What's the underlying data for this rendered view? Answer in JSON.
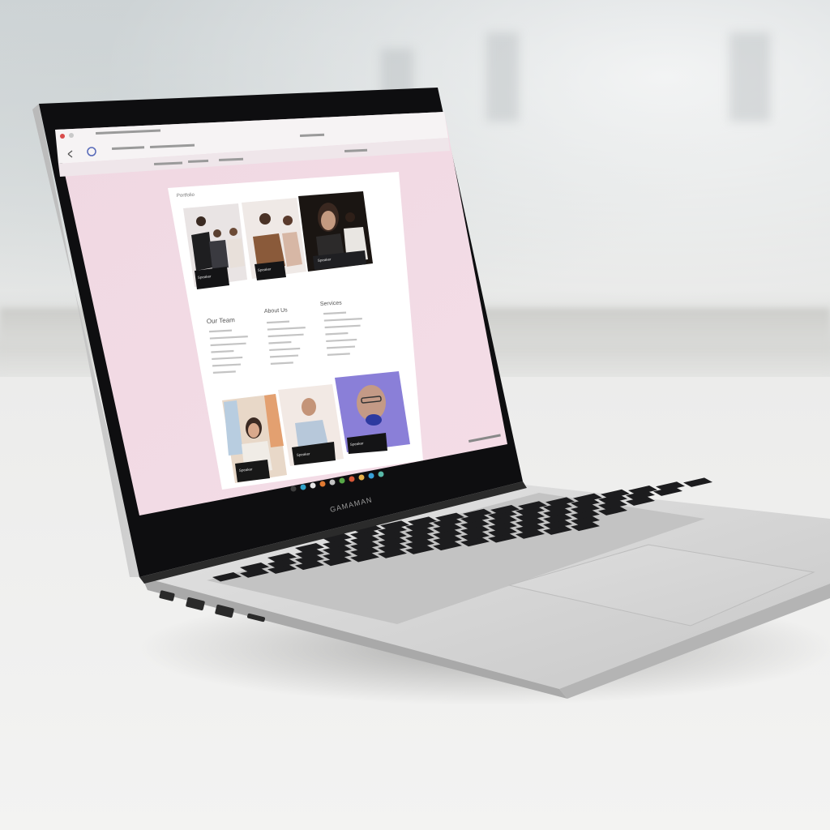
{
  "photo": {
    "subject": "laptop",
    "laptop_brand_text": "GAMAMAN"
  },
  "screen": {
    "background": "#f1dbe4",
    "page_card_heading": "Portfolio",
    "section_titles": [
      "Our Team",
      "About Us",
      "Services"
    ],
    "card_captions": [
      "Speaker",
      "Speaker",
      "Speaker",
      "Speaker",
      "Speaker",
      "Speaker"
    ]
  },
  "colors": {
    "screen_pink": "#f1dbe4",
    "laptop_silver": "#d9d9d9",
    "bezel": "#0e0e10",
    "photo_purple": "#8a7fd8"
  }
}
